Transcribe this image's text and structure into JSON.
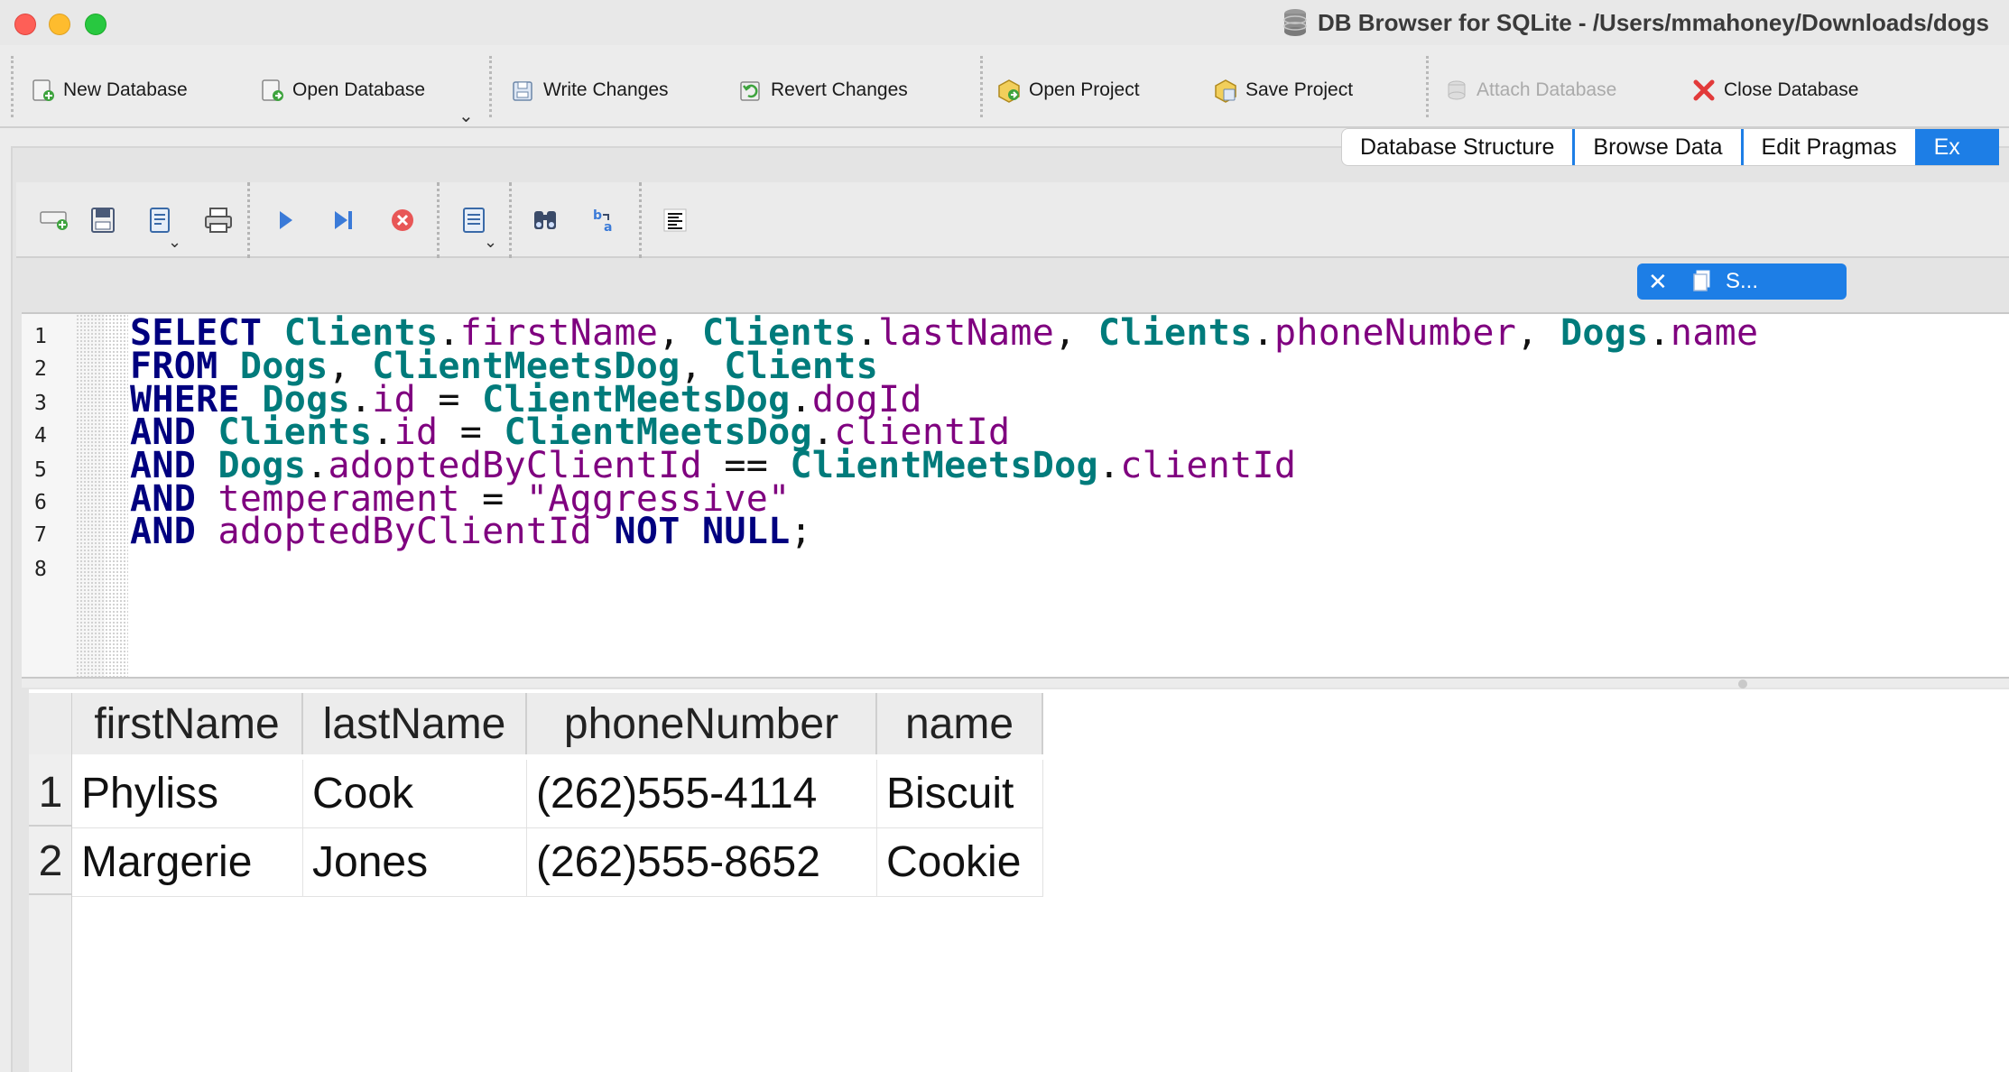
{
  "window": {
    "title": "DB Browser for SQLite - /Users/mmahoney/Downloads/dogs"
  },
  "toolbar": {
    "new_database": "New Database",
    "open_database": "Open Database",
    "write_changes": "Write Changes",
    "revert_changes": "Revert Changes",
    "open_project": "Open Project",
    "save_project": "Save Project",
    "attach_database": "Attach Database",
    "close_database": "Close Database"
  },
  "tabs": [
    "Database Structure",
    "Browse Data",
    "Edit Pragmas",
    "Ex"
  ],
  "sql_tab": {
    "label": "S..."
  },
  "editor": {
    "line_numbers": [
      "1",
      "2",
      "3",
      "4",
      "5",
      "6",
      "7",
      "8"
    ],
    "tokens": {
      "select": "SELECT",
      "from": "FROM",
      "where": "WHERE",
      "and": "AND",
      "not": "NOT",
      "null": "NULL",
      "clients": "Clients",
      "dogs": "Dogs",
      "cmd": "ClientMeetsDog",
      "firstName": "firstName",
      "lastName": "lastName",
      "phoneNumber": "phoneNumber",
      "name": "name",
      "id": "id",
      "dogId": "dogId",
      "clientId": "clientId",
      "adoptedByClientId": "adoptedByClientId",
      "temperament": "temperament",
      "aggressive": "\"Aggressive\"",
      "dot": ".",
      "comma": ", ",
      "eq": " = ",
      "eqeq": " == ",
      "semi": ";"
    }
  },
  "results": {
    "columns": [
      "firstName",
      "lastName",
      "phoneNumber",
      "name"
    ],
    "rows": [
      {
        "num": "1",
        "cells": [
          "Phyliss",
          "Cook",
          "(262)555-4114",
          "Biscuit"
        ]
      },
      {
        "num": "2",
        "cells": [
          "Margerie",
          "Jones",
          "(262)555-8652",
          "Cookie"
        ]
      }
    ]
  },
  "colors": {
    "keyword": "#00007f",
    "table": "#007b7b",
    "column": "#7f007f",
    "accent": "#1d7ee6"
  }
}
